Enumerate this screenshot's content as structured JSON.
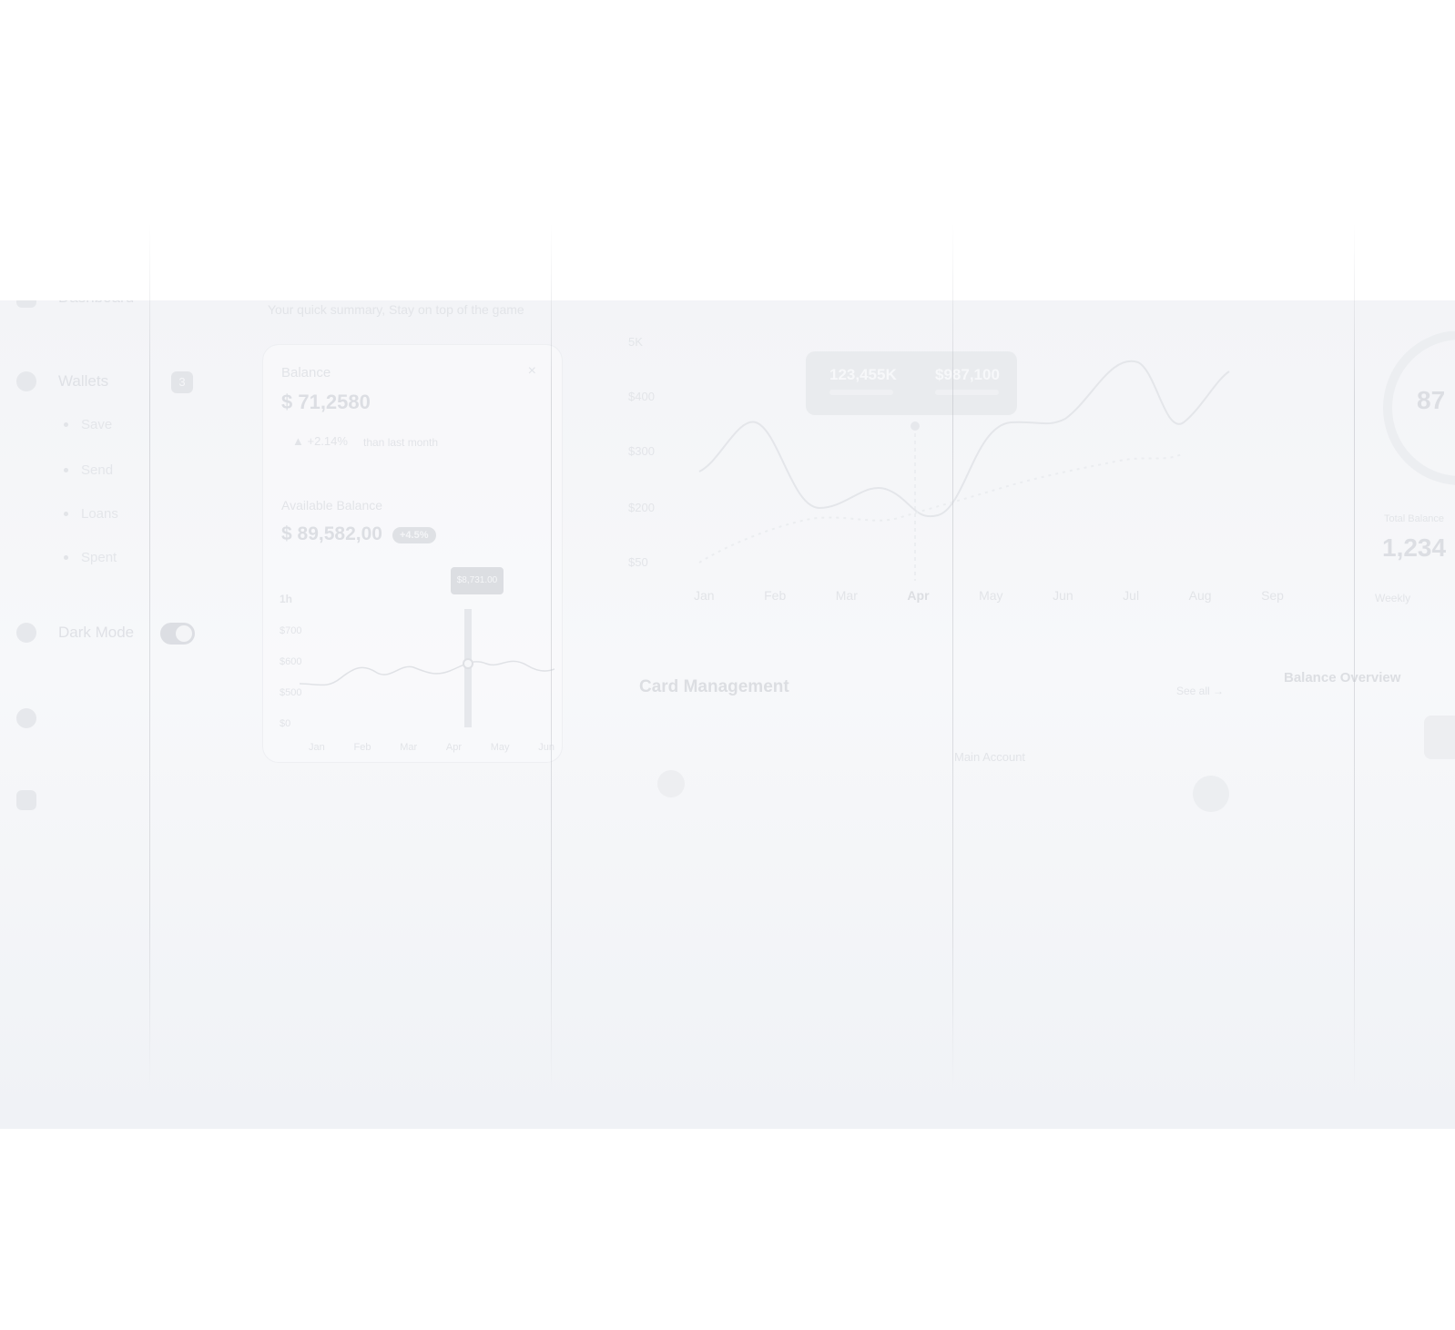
{
  "sidebar": {
    "items": [
      {
        "label": "Dashboard",
        "icon": "dashboard-icon"
      },
      {
        "label": "Wallets",
        "icon": "wallet-icon",
        "badge": "3"
      },
      {
        "label": "Dark Mode",
        "icon": "moon-icon"
      },
      {
        "label": "",
        "icon": "settings-icon"
      },
      {
        "label": "",
        "icon": "logout-icon"
      }
    ],
    "subitems": [
      "Save",
      "Send",
      "Loans",
      "Spent"
    ]
  },
  "balance_card": {
    "subtitle": "Your quick summary, Stay on top of the game",
    "balance_label": "Balance",
    "balance_value": "$ 71,2580",
    "change": "+2.14%",
    "change_note": "than last month",
    "available_label": "Available Balance",
    "available_value": "$ 89,582,00",
    "available_badge": "+4.5%",
    "range": "1h",
    "tooltip": "$8,731.00",
    "y_ticks": [
      "$700",
      "$600",
      "$500",
      "$0"
    ],
    "x_ticks": [
      "Jan",
      "Feb",
      "Mar",
      "Apr",
      "May",
      "Jun"
    ]
  },
  "main_chart": {
    "y_ticks": [
      "5K",
      "$400",
      "$300",
      "$200",
      "$50"
    ],
    "x_ticks": [
      "Jan",
      "Feb",
      "Mar",
      "Apr",
      "May",
      "Jun",
      "Jul",
      "Aug",
      "Sep"
    ],
    "tooltip_left": "123,455K",
    "tooltip_right": "$987,100"
  },
  "card_management": {
    "title": "Card Management",
    "link": "See all",
    "label": "Main Account"
  },
  "right_panel": {
    "gauge_value": "87",
    "total_label": "Total Balance",
    "total_value": "1,234",
    "title": "Balance Overview",
    "x_label": "Weekly"
  }
}
